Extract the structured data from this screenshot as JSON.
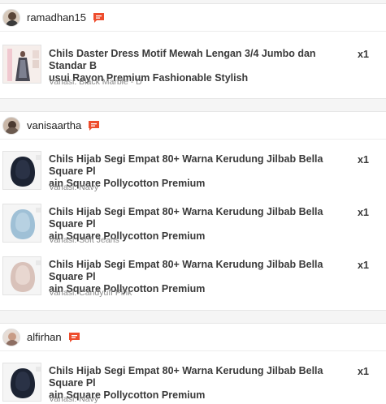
{
  "orders": [
    {
      "buyer": "ramadhan15",
      "items": [
        {
          "name_line1": "Chils Daster Dress Motif Mewah Lengan 3/4 Jumbo dan Standar B",
          "name_line2": "usui Rayon Premium Fashionable Stylish",
          "qty": "x1",
          "variant": "Variasi: Black Marble - D",
          "thumb": "dress-photo"
        }
      ]
    },
    {
      "buyer": "vanisaartha",
      "items": [
        {
          "name_line1": "Chils Hijab Segi Empat 80+ Warna Kerudung Jilbab Bella Square Pl",
          "name_line2": "ain Square Pollycotton Premium",
          "qty": "x1",
          "variant": "Variasi: Navy",
          "thumb": "hijab-navy",
          "color": "#1c2333"
        },
        {
          "name_line1": "Chils Hijab Segi Empat 80+ Warna Kerudung Jilbab Bella Square Pl",
          "name_line2": "ain Square Pollycotton Premium",
          "qty": "x1",
          "variant": "Variasi: Soft Jeans",
          "thumb": "hijab-soft-jeans",
          "color": "#9fc0d6"
        },
        {
          "name_line1": "Chils Hijab Segi Empat 80+ Warna Kerudung Jilbab Bella Square Pl",
          "name_line2": "ain Square Pollycotton Premium",
          "qty": "x1",
          "variant": "Variasi: Candyuff Pink",
          "thumb": "hijab-candyuff-pink",
          "color": "#e2cfc8"
        }
      ]
    },
    {
      "buyer": "alfirhan",
      "items": [
        {
          "name_line1": "Chils Hijab Segi Empat 80+ Warna Kerudung Jilbab Bella Square Pl",
          "name_line2": "ain Square Pollycotton Premium",
          "qty": "x1",
          "variant": "Variasi: Navy",
          "thumb": "hijab-navy",
          "color": "#1c2333"
        }
      ]
    }
  ],
  "icons": {
    "chat": "chat-icon",
    "accent": "#ee4d2d"
  }
}
